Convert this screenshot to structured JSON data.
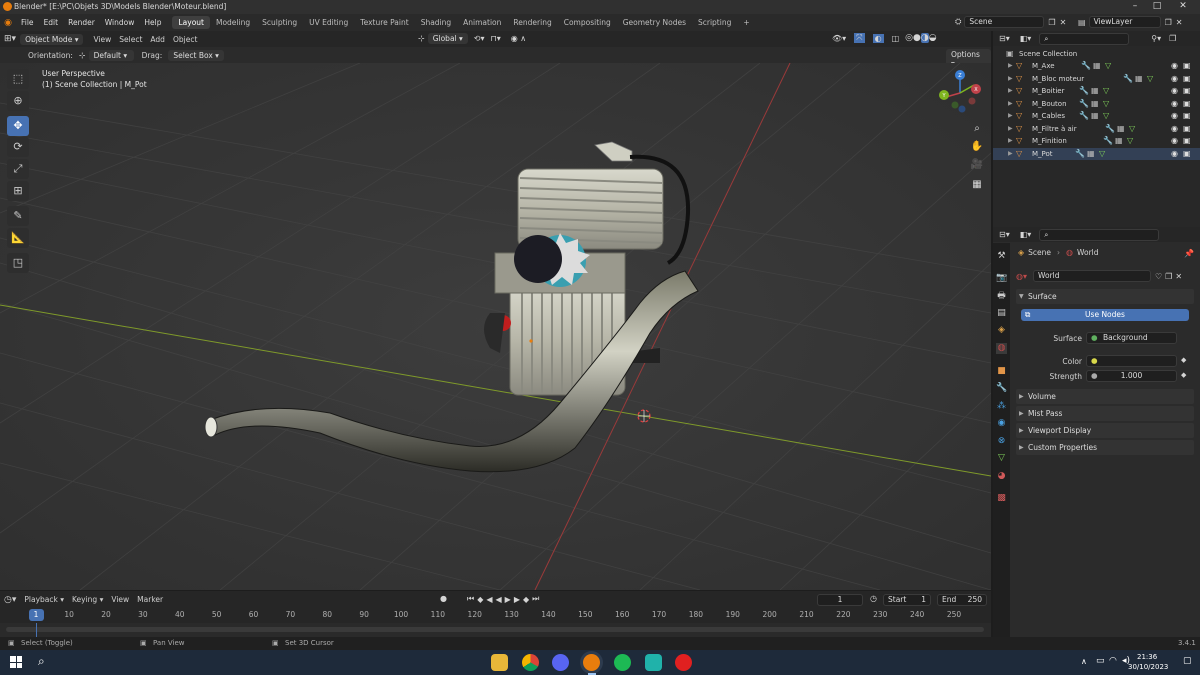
{
  "window": {
    "title": "Blender* [E:\\PC\\Objets 3D\\Models Blender\\Moteur.blend]",
    "controls": [
      "–",
      "□",
      "✕"
    ]
  },
  "menu": {
    "items": [
      "File",
      "Edit",
      "Render",
      "Window",
      "Help"
    ],
    "workspaces": [
      "Layout",
      "Modeling",
      "Sculpting",
      "UV Editing",
      "Texture Paint",
      "Shading",
      "Animation",
      "Rendering",
      "Compositing",
      "Geometry Nodes",
      "Scripting"
    ],
    "active_workspace": "Layout",
    "add_workspace": "+",
    "scene": "Scene",
    "view_layer": "ViewLayer"
  },
  "viewport_header": {
    "mode": "Object Mode",
    "menus": [
      "View",
      "Select",
      "Add",
      "Object"
    ],
    "transform": "Global",
    "options": "Options"
  },
  "tool_settings": {
    "orientation_label": "Orientation:",
    "orientation_value": "Default",
    "drag_label": "Drag:",
    "drag_value": "Select Box"
  },
  "viewport": {
    "perspective": "User Perspective",
    "collection_info": "(1) Scene Collection | M_Pot",
    "gizmo_axes": [
      "X",
      "Y",
      "Z"
    ]
  },
  "toolbar": {
    "tools": [
      "select-tool",
      "cursor-tool",
      "move-tool",
      "rotate-tool",
      "scale-tool",
      "transform-tool",
      "annotate-tool",
      "measure-tool",
      "add-cube-tool"
    ],
    "active_tool": "move-tool"
  },
  "outliner": {
    "root": "Scene Collection",
    "items": [
      {
        "name": "M_Axe"
      },
      {
        "name": "M_Bloc moteur"
      },
      {
        "name": "M_Boitier"
      },
      {
        "name": "M_Bouton"
      },
      {
        "name": "M_Cables"
      },
      {
        "name": "M_Filtre à air"
      },
      {
        "name": "M_Finition"
      },
      {
        "name": "M_Pot"
      }
    ],
    "selected": "M_Pot"
  },
  "properties": {
    "breadcrumb": [
      "Scene",
      "World"
    ],
    "world_name": "World",
    "panels": {
      "surface": "Surface",
      "use_nodes": "Use Nodes",
      "surface_label": "Surface",
      "surface_value": "Background",
      "color_label": "Color",
      "strength_label": "Strength",
      "strength_value": "1.000"
    },
    "collapsed_panels": [
      "Volume",
      "Mist Pass",
      "Viewport Display",
      "Custom Properties"
    ]
  },
  "timeline": {
    "menus": [
      "Playback",
      "Keying",
      "View",
      "Marker"
    ],
    "current_frame": "1",
    "start_label": "Start",
    "start_value": "1",
    "end_label": "End",
    "end_value": "250",
    "ruler": [
      "1",
      "10",
      "20",
      "30",
      "40",
      "50",
      "60",
      "70",
      "80",
      "90",
      "100",
      "110",
      "120",
      "130",
      "140",
      "150",
      "160",
      "170",
      "180",
      "190",
      "200",
      "210",
      "220",
      "230",
      "240",
      "250"
    ]
  },
  "statusbar": {
    "hints": [
      "Select (Toggle)",
      "Pan View",
      "Set 3D Cursor"
    ],
    "version": "3.4.1"
  },
  "taskbar": {
    "time": "21:36",
    "date": "30/10/2023"
  },
  "colors": {
    "accent": "#4772b3",
    "object_orange": "#e29548",
    "axis_x": "#c0424a",
    "axis_y": "#7fb51f",
    "axis_z": "#3a7fd6"
  }
}
